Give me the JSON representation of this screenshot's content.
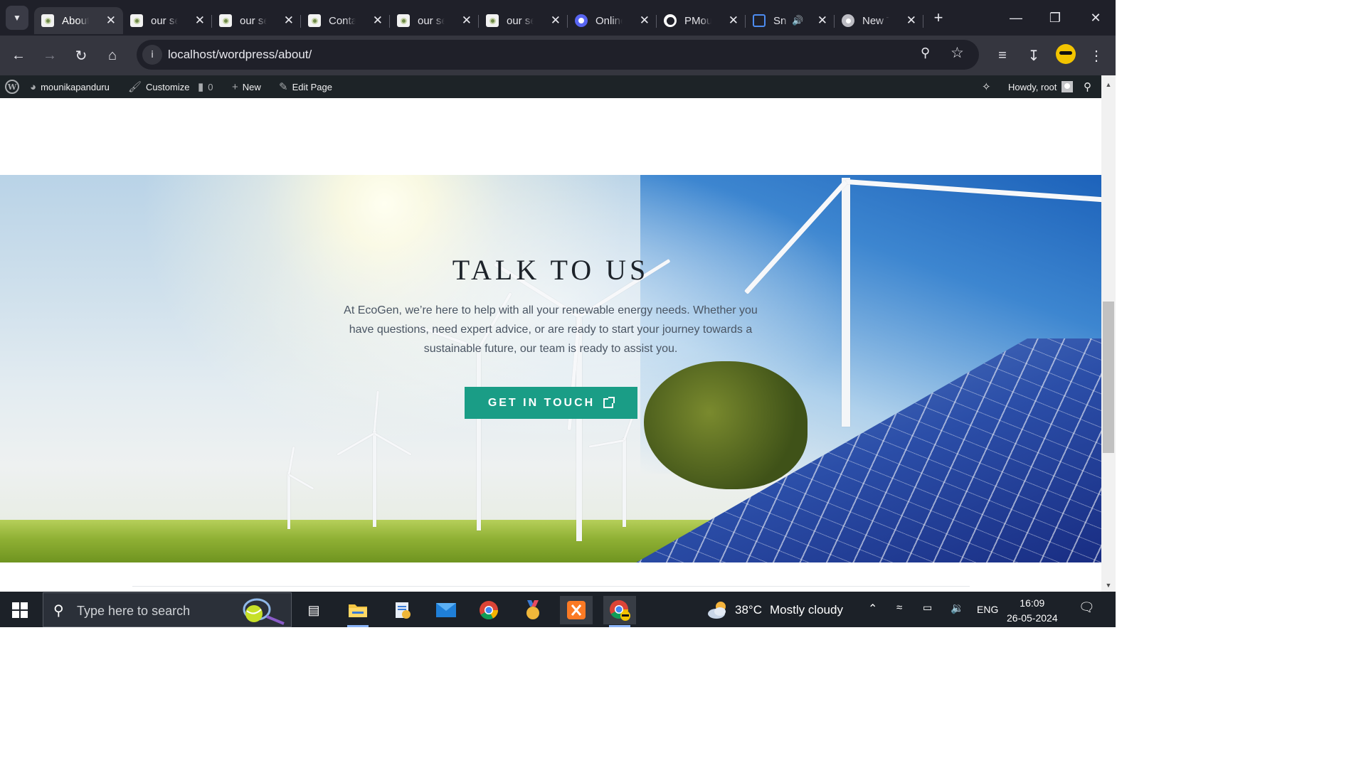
{
  "browser": {
    "tabs": [
      {
        "title": "About",
        "icon": "site-favicon",
        "active": true
      },
      {
        "title": "our se",
        "icon": "site-favicon"
      },
      {
        "title": "our se",
        "icon": "site-favicon"
      },
      {
        "title": "Conta",
        "icon": "site-favicon"
      },
      {
        "title": "our se",
        "icon": "site-favicon"
      },
      {
        "title": "our se",
        "icon": "site-favicon"
      },
      {
        "title": "Online",
        "icon": "circle-favicon"
      },
      {
        "title": "PMou",
        "icon": "github-favicon"
      },
      {
        "title": "Sn",
        "icon": "screen-favicon",
        "audio": true
      },
      {
        "title": "New T",
        "icon": "chrome-favicon"
      }
    ],
    "url": "localhost/wordpress/about/"
  },
  "admin_bar": {
    "site_name": "mounikapanduru",
    "customize": "Customize",
    "comments_count": "0",
    "new_label": "New",
    "edit_page": "Edit Page",
    "howdy": "Howdy, root"
  },
  "hero": {
    "title": "TALK TO US",
    "text": "At EcoGen, we’re here to help with all your renewable energy needs. Whether you have questions, need expert advice, or are ready to start your journey towards a sustainable future, our team is ready to assist you.",
    "cta_label": "GET IN TOUCH",
    "cta_color": "#1a9d86"
  },
  "taskbar": {
    "search_placeholder": "Type here to search",
    "weather_temp": "38°C",
    "weather_text": "Mostly cloudy",
    "language": "ENG",
    "time": "16:09",
    "date": "26-05-2024"
  }
}
